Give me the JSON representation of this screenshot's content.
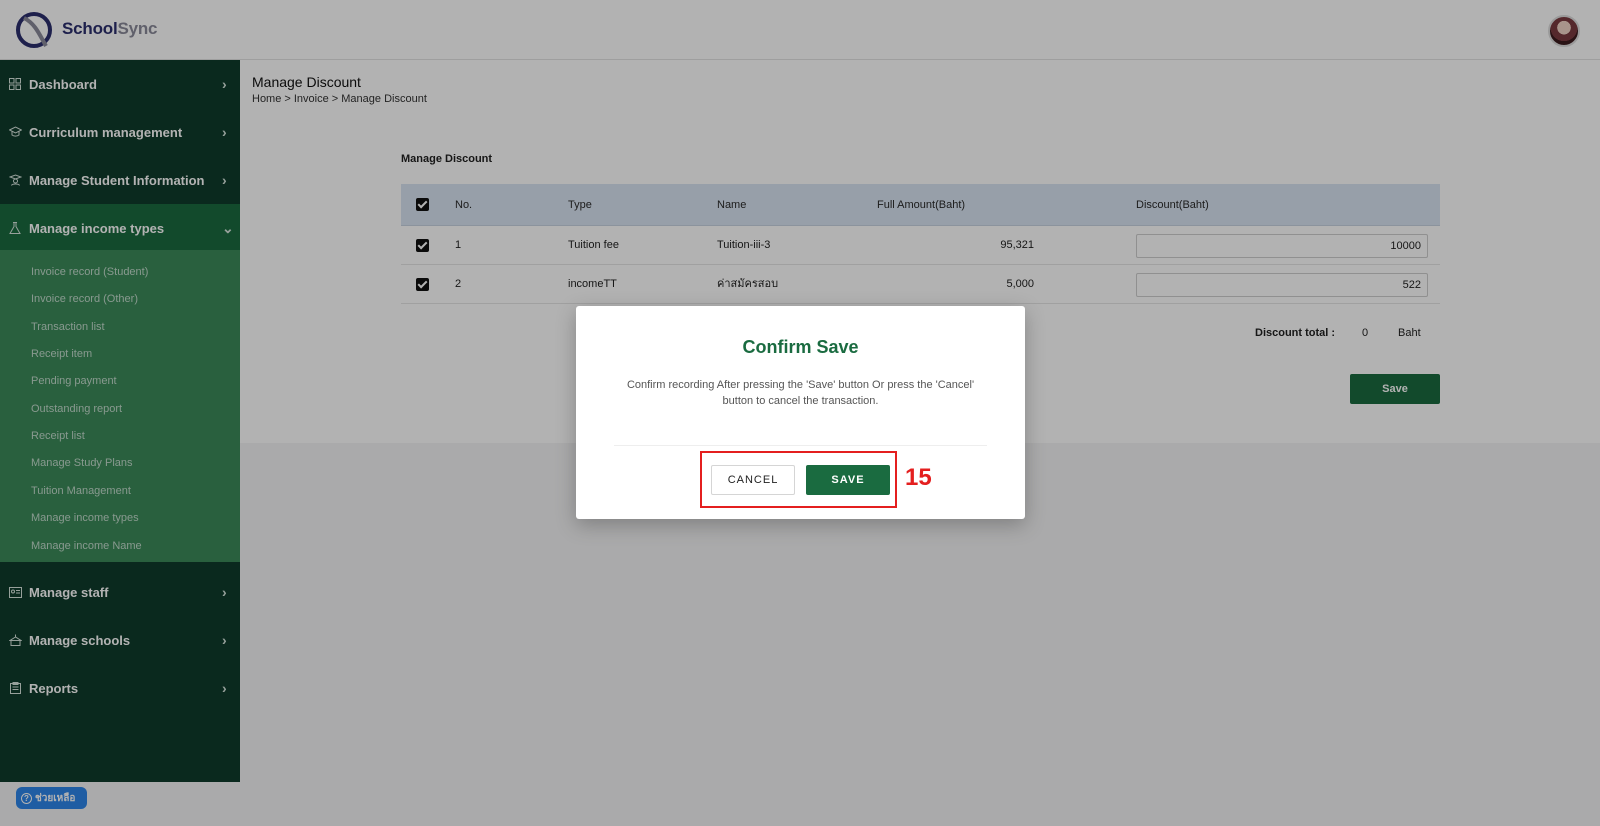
{
  "header": {
    "brand_part1": "School",
    "brand_part2": "Sync"
  },
  "sidebar": {
    "items": [
      {
        "label": "Dashboard",
        "icon": "grid-icon"
      },
      {
        "label": "Curriculum management",
        "icon": "graduation-cap-icon"
      },
      {
        "label": "Manage Student Information",
        "icon": "student-icon"
      },
      {
        "label": "Manage income types",
        "icon": "flask-icon",
        "expanded": true
      },
      {
        "label": "Manage staff",
        "icon": "id-card-icon"
      },
      {
        "label": "Manage schools",
        "icon": "school-icon"
      },
      {
        "label": "Reports",
        "icon": "clipboard-icon"
      }
    ],
    "submenu": [
      "Invoice record (Student)",
      "Invoice record (Other)",
      "Transaction list",
      "Receipt item",
      "Pending payment",
      "Outstanding report",
      "Receipt list",
      "Manage Study Plans",
      "Tuition Management",
      "Manage income types",
      "Manage income Name"
    ]
  },
  "page": {
    "title": "Manage Discount",
    "breadcrumb": "Home > Invoice > Manage Discount"
  },
  "card": {
    "title": "Manage Discount",
    "columns": [
      "No.",
      "Type",
      "Name",
      "Full Amount(Baht)",
      "Discount(Baht)"
    ],
    "rows": [
      {
        "no": "1",
        "type": "Tuition fee",
        "name": "Tuition-iii-3",
        "full_amount": "95,321",
        "discount": "10000",
        "checked": true
      },
      {
        "no": "2",
        "type": "incomeTT",
        "name": "ค่าสมัครสอบ",
        "full_amount": "5,000",
        "discount": "522",
        "checked": true
      }
    ],
    "total_label": "Discount total :",
    "total_value": "0",
    "total_unit": "Baht",
    "save_label": "Save"
  },
  "help": {
    "label": "ช่วยเหลือ"
  },
  "modal": {
    "title": "Confirm Save",
    "message": "Confirm recording After pressing the 'Save' button Or press the 'Cancel' button to cancel the transaction.",
    "cancel_label": "CANCEL",
    "save_label": "SAVE"
  },
  "annotation": {
    "step": "15",
    "color": "#e41f1f"
  },
  "colors": {
    "primary": "#1a6b40",
    "sidebar": "#0f3c2c",
    "submenu": "#3c8a5a"
  }
}
